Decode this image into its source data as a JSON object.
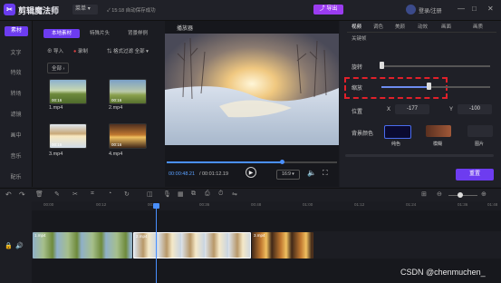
{
  "app": {
    "name": "剪辑魔法师",
    "menu_label": "菜单",
    "save_status": "15:18 自动保存成功",
    "export_label": "导出",
    "login_label": "登录/注册",
    "win_controls": [
      "—",
      "□",
      "✕"
    ]
  },
  "sidenav": {
    "items": [
      {
        "label": "素材",
        "active": true
      },
      {
        "label": "文字"
      },
      {
        "label": "特效"
      },
      {
        "label": "转场"
      },
      {
        "label": "滤镜"
      },
      {
        "label": "画中"
      },
      {
        "label": "音乐"
      },
      {
        "label": "配乐"
      }
    ]
  },
  "media": {
    "tabs": [
      "本地素材",
      "特殊片头",
      "背景样例"
    ],
    "import_label": "导入",
    "record_label": "录制",
    "format_label": "格式过滤",
    "filter_value": "全部",
    "all_label": "全部",
    "files": [
      {
        "name": "1.mp4",
        "duration": "00:16"
      },
      {
        "name": "2.mp4",
        "duration": "00:16"
      },
      {
        "name": "3.mp4",
        "duration": "00:16"
      },
      {
        "name": "4.mp4",
        "duration": "00:16"
      }
    ]
  },
  "player": {
    "title": "播放器",
    "time_current": "00:00:48.21",
    "time_total": "00:01:12.19",
    "ratio": "16:9",
    "progress": 0.67
  },
  "props": {
    "tabs": [
      "视频",
      "调色",
      "美颜",
      "动效",
      "画面",
      "画质",
      "关键帧"
    ],
    "rotate_label": "旋转",
    "scale_label": "缩放",
    "position_label": "位置",
    "pos_x_label": "X",
    "pos_x": "-177",
    "pos_y_label": "Y",
    "pos_y": "-100",
    "bg_label": "背景颜色",
    "bg_options": [
      "纯色",
      "模糊",
      "图片"
    ],
    "reset_label": "重置"
  },
  "timeline": {
    "ticks": [
      "00:00",
      "00:12",
      "00:24",
      "00:36",
      "00:48",
      "01:00",
      "01:12",
      "01:24",
      "01:36",
      "01:48"
    ],
    "clips": [
      "1.mp4",
      "2.mp4",
      "3.mp4"
    ]
  },
  "watermark": "CSDN @chenmuchen_"
}
